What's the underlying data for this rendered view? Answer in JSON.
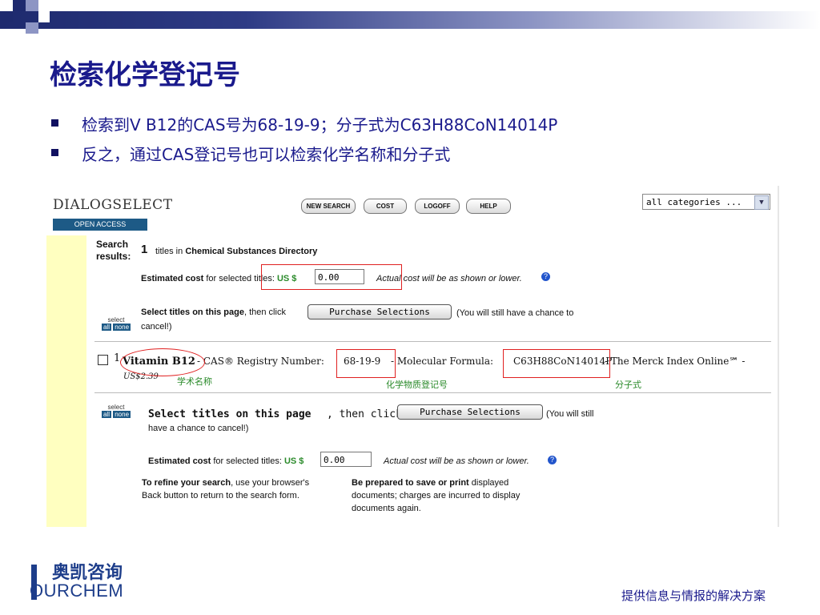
{
  "slide": {
    "title": "检索化学登记号",
    "bullets": [
      "检索到V B12的CAS号为68-19-9；分子式为C63H88CoN14014P",
      "反之，通过CAS登记号也可以检索化学名称和分子式"
    ],
    "footer": "提供信息与情报的解决方案"
  },
  "brand": {
    "name_cn": "奥凯咨询",
    "name_en": "OURCHEM"
  },
  "dialog": {
    "logo": "DIALOGSELECT",
    "open_access": "OPEN ACCESS",
    "nav": [
      "NEW SEARCH",
      "COST",
      "LOGOFF",
      "HELP"
    ],
    "category_select": "all categories ...",
    "search_results_label": "Search results:",
    "result_count": "1",
    "titles_in": "titles in",
    "database": "Chemical Substances Directory",
    "est_cost_label": "Estimated cost",
    "est_cost_rest": "for selected titles:",
    "currency": "US $",
    "cost_value": "0.00",
    "actual_cost_note": "Actual cost will be as shown or lower.",
    "select_titles_label": "Select titles on this page",
    "then_click": ", then click",
    "purchase_button": "Purchase Selections",
    "chance_text": "(You will still have a chance to",
    "cancel_text": "cancel!)",
    "chance_text_2": "(You will still",
    "cancel_text_2": "have a chance to cancel!)",
    "select_word": "select",
    "all_label": "all",
    "none_label": "none",
    "refine_bold": "To refine your search",
    "refine_rest_1": ", use your browser's",
    "refine_rest_2": "Back button to return to the search form.",
    "prepared_bold": "Be prepared to save or print",
    "prepared_rest_1": " displayed",
    "prepared_rest_2": "documents; charges are incurred to display",
    "prepared_rest_3": "documents again.",
    "record": {
      "number": "1",
      "name": "Vitamin B12",
      "sep1": " - CAS® Registry Number:",
      "cas": "68-19-9",
      "sep2": " - Molecular Formula:",
      "formula": "C63H88CoN14014P",
      "tail": " - The Merck Index Online℠ -",
      "price": "US$2.39"
    },
    "annotations": {
      "name": "学术名称",
      "cas": "化学物质登记号",
      "formula": "分子式"
    }
  },
  "colors": {
    "title": "#1a1a8c",
    "annotation": "#e02020",
    "cost_green": "#2a8a2a",
    "sidebar": "#ffffc0"
  }
}
